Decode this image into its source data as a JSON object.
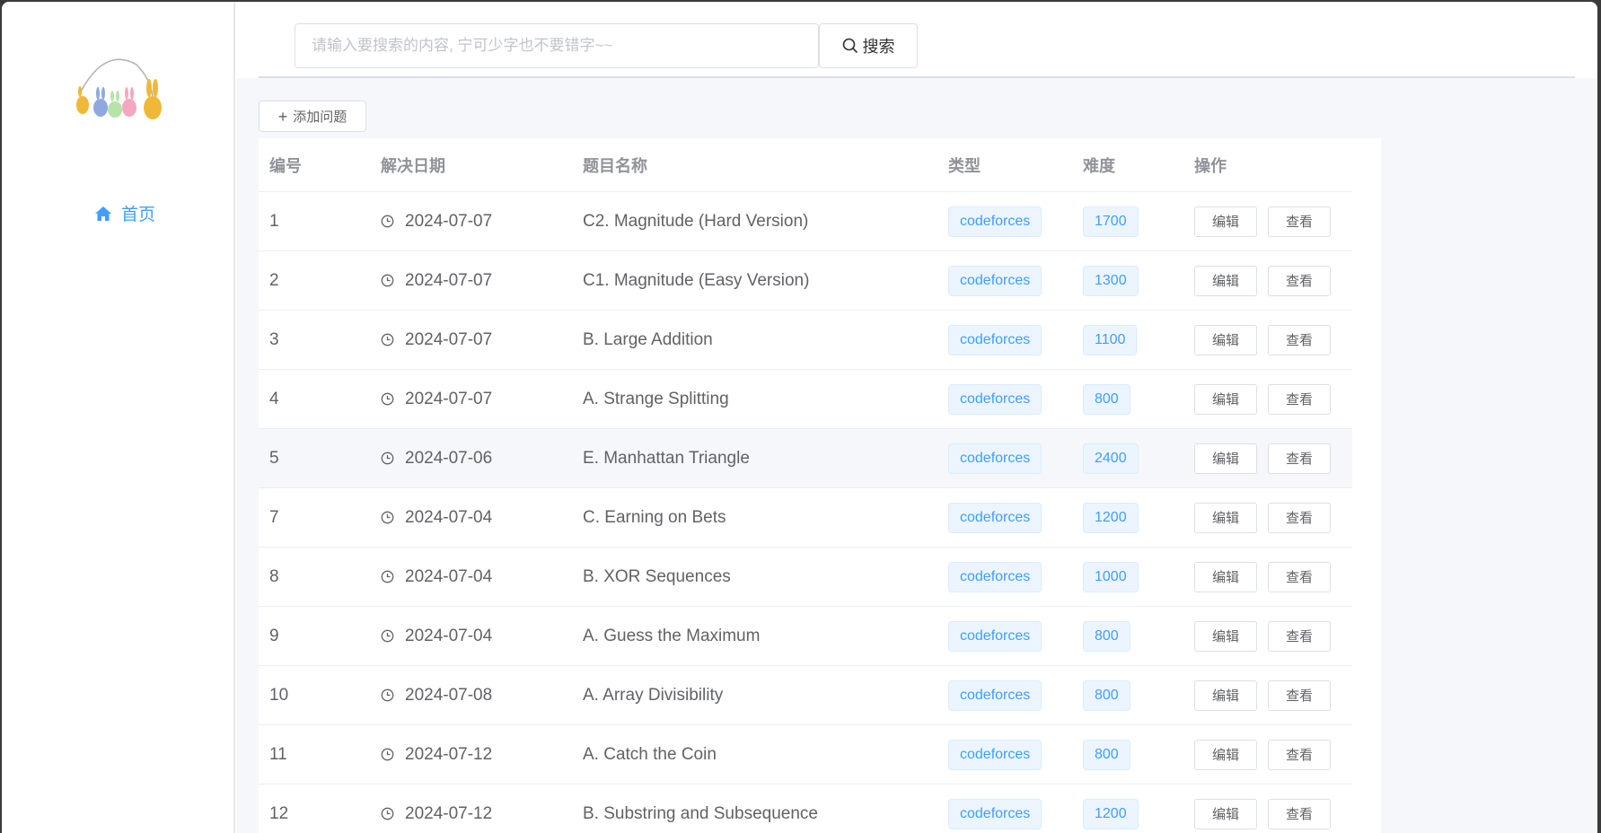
{
  "sidebar": {
    "nav": {
      "home_label": "首页"
    }
  },
  "search": {
    "placeholder": "请输入要搜索的内容, 宁可少字也不要错字~~",
    "button_label": "搜索"
  },
  "toolbar": {
    "add_label": "添加问题"
  },
  "table": {
    "headers": [
      "编号",
      "解决日期",
      "题目名称",
      "类型",
      "难度",
      "操作"
    ],
    "rows": [
      {
        "id": "1",
        "date": "2024-07-07",
        "title": "C2. Magnitude (Hard Version)",
        "type": "codeforces",
        "difficulty": "1700"
      },
      {
        "id": "2",
        "date": "2024-07-07",
        "title": "C1. Magnitude (Easy Version)",
        "type": "codeforces",
        "difficulty": "1300"
      },
      {
        "id": "3",
        "date": "2024-07-07",
        "title": "B. Large Addition",
        "type": "codeforces",
        "difficulty": "1100"
      },
      {
        "id": "4",
        "date": "2024-07-07",
        "title": "A. Strange Splitting",
        "type": "codeforces",
        "difficulty": "800"
      },
      {
        "id": "5",
        "date": "2024-07-06",
        "title": "E. Manhattan Triangle",
        "type": "codeforces",
        "difficulty": "2400"
      },
      {
        "id": "7",
        "date": "2024-07-04",
        "title": "C. Earning on Bets",
        "type": "codeforces",
        "difficulty": "1200"
      },
      {
        "id": "8",
        "date": "2024-07-04",
        "title": "B. XOR Sequences",
        "type": "codeforces",
        "difficulty": "1000"
      },
      {
        "id": "9",
        "date": "2024-07-04",
        "title": "A. Guess the Maximum",
        "type": "codeforces",
        "difficulty": "800"
      },
      {
        "id": "10",
        "date": "2024-07-08",
        "title": "A. Array Divisibility",
        "type": "codeforces",
        "difficulty": "800"
      },
      {
        "id": "11",
        "date": "2024-07-12",
        "title": "A. Catch the Coin",
        "type": "codeforces",
        "difficulty": "800"
      },
      {
        "id": "12",
        "date": "2024-07-12",
        "title": "B. Substring and Subsequence",
        "type": "codeforces",
        "difficulty": "1200"
      }
    ],
    "edit_label": "编辑",
    "view_label": "查看"
  },
  "colors": {
    "accent": "#409eff",
    "tag_bg": "#ecf5ff"
  }
}
